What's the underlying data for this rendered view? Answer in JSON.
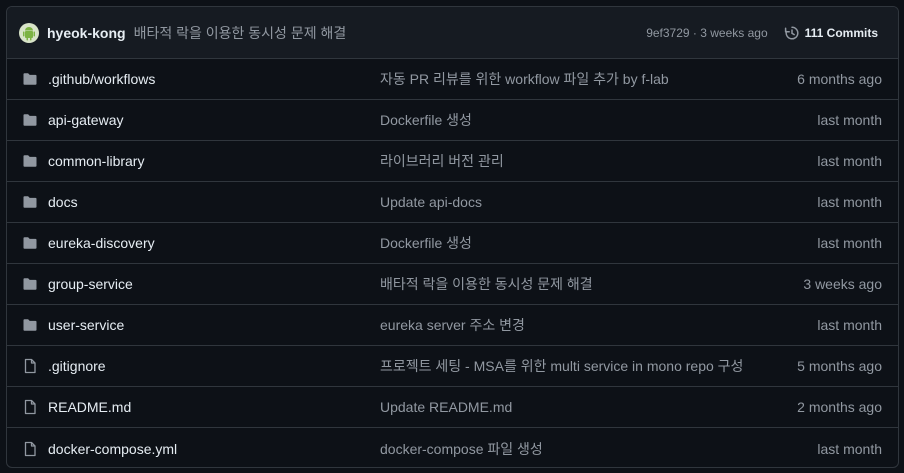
{
  "header": {
    "author": "hyeok-kong",
    "commit_message": "배타적 락을 이용한 동시성 문제 해결",
    "sha_age": "9ef3729 · 3 weeks ago",
    "commits_label": "111 Commits"
  },
  "files": [
    {
      "type": "folder",
      "name": ".github/workflows",
      "message": "자동 PR 리뷰를 위한 workflow 파일 추가 by f-lab",
      "age": "6 months ago"
    },
    {
      "type": "folder",
      "name": "api-gateway",
      "message": "Dockerfile 생성",
      "age": "last month"
    },
    {
      "type": "folder",
      "name": "common-library",
      "message": "라이브러리 버전 관리",
      "age": "last month"
    },
    {
      "type": "folder",
      "name": "docs",
      "message": "Update api-docs",
      "age": "last month"
    },
    {
      "type": "folder",
      "name": "eureka-discovery",
      "message": "Dockerfile 생성",
      "age": "last month"
    },
    {
      "type": "folder",
      "name": "group-service",
      "message": "배타적 락을 이용한 동시성 문제 해결",
      "age": "3 weeks ago"
    },
    {
      "type": "folder",
      "name": "user-service",
      "message": "eureka server 주소 변경",
      "age": "last month"
    },
    {
      "type": "file",
      "name": ".gitignore",
      "message": "프로젝트 세팅 - MSA를 위한 multi service in mono repo 구성",
      "age": "5 months ago"
    },
    {
      "type": "file",
      "name": "README.md",
      "message": "Update README.md",
      "age": "2 months ago"
    },
    {
      "type": "file",
      "name": "docker-compose.yml",
      "message": "docker-compose 파일 생성",
      "age": "last month"
    }
  ],
  "colors": {
    "background": "#0d1117",
    "header": "#161b22",
    "border": "#30363d",
    "muted": "#9198a1"
  }
}
